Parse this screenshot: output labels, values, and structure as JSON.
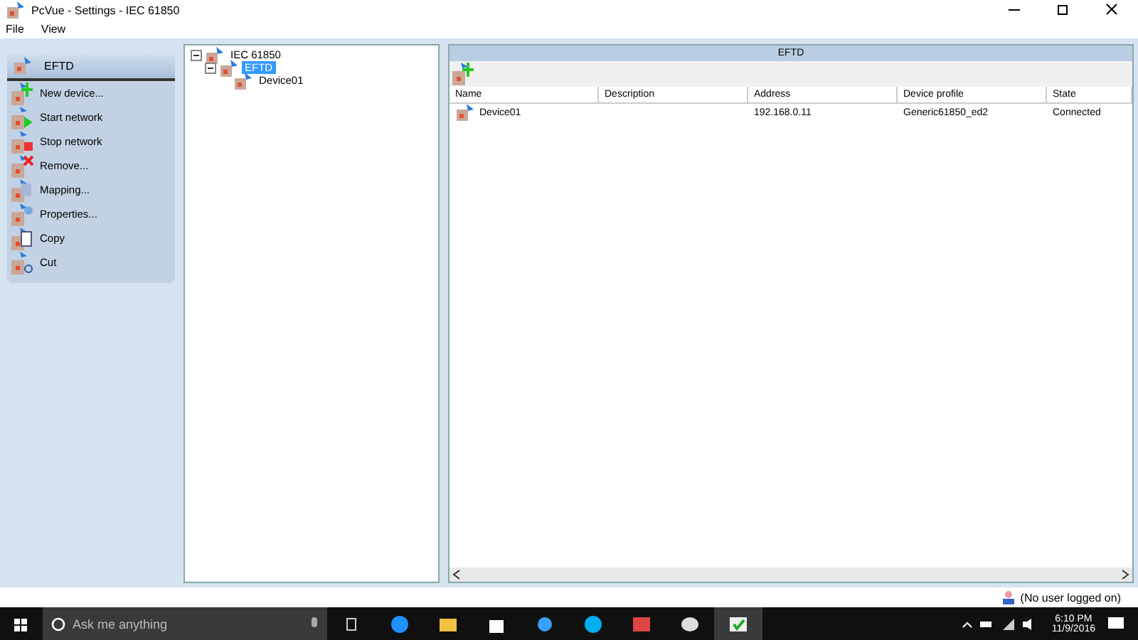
{
  "window": {
    "title": "PcVue - Settings - IEC 61850"
  },
  "menu": [
    "File",
    "View"
  ],
  "action_panel": {
    "title": "EFTD",
    "items": [
      {
        "label": "New device...",
        "kind": "add"
      },
      {
        "label": "Start network",
        "kind": "start"
      },
      {
        "label": "Stop network",
        "kind": "stop"
      },
      {
        "label": "Remove...",
        "kind": "remove"
      },
      {
        "label": "Mapping...",
        "kind": "mapping"
      },
      {
        "label": "Properties...",
        "kind": "properties"
      },
      {
        "label": "Copy",
        "kind": "copy"
      },
      {
        "label": "Cut",
        "kind": "cut"
      }
    ]
  },
  "tree": [
    {
      "label": "IEC 61850",
      "expanded": true,
      "selected": false,
      "children": [
        {
          "label": "EFTD",
          "expanded": true,
          "selected": true,
          "children": [
            {
              "label": "Device01",
              "selected": false
            }
          ]
        }
      ]
    }
  ],
  "detail": {
    "title": "EFTD",
    "table": {
      "columns": [
        "Name",
        "Description",
        "Address",
        "Device profile",
        "State"
      ],
      "rows": [
        [
          "Device01",
          "",
          "192.168.0.11",
          "Generic61850_ed2",
          "Connected"
        ]
      ]
    }
  },
  "status_bar": {
    "user": "(No user logged on)"
  },
  "taskbar": {
    "search_placeholder": "Ask me anything",
    "time": "6:10 PM",
    "date": "11/9/2016"
  }
}
